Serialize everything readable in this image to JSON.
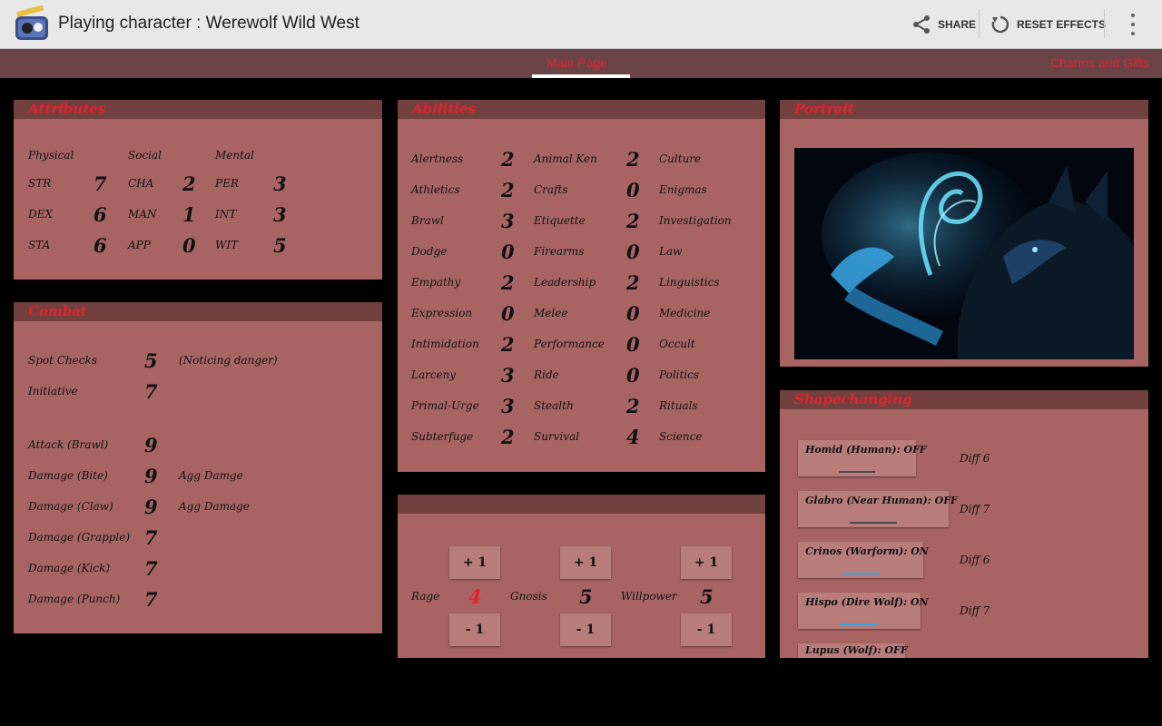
{
  "app": {
    "title": "Playing character : Werewolf Wild West",
    "share_label": "SHARE",
    "reset_label": "RESET EFFECTS"
  },
  "tabs": [
    {
      "label": "Main Page"
    },
    {
      "label": "Charms and Gifts"
    }
  ],
  "attributes": {
    "title": "Attributes",
    "headers": [
      "Physical",
      "Social",
      "Mental"
    ],
    "rows": [
      [
        {
          "label": "STR",
          "value": "7"
        },
        {
          "label": "CHA",
          "value": "2"
        },
        {
          "label": "PER",
          "value": "3"
        }
      ],
      [
        {
          "label": "DEX",
          "value": "6"
        },
        {
          "label": "MAN",
          "value": "1"
        },
        {
          "label": "INT",
          "value": "3"
        }
      ],
      [
        {
          "label": "STA",
          "value": "6"
        },
        {
          "label": "APP",
          "value": "0"
        },
        {
          "label": "WIT",
          "value": "5"
        }
      ]
    ]
  },
  "combat": {
    "title": "Combat",
    "rows": [
      {
        "label": "Spot Checks",
        "value": "5",
        "note": "(Noticing danger)"
      },
      {
        "label": "Initiative",
        "value": "7",
        "note": ""
      },
      {
        "label": "Attack (Brawl)",
        "value": "9",
        "note": ""
      },
      {
        "label": "Damage (Bite)",
        "value": "9",
        "note": "Agg Damge"
      },
      {
        "label": "Damage (Claw)",
        "value": "9",
        "note": "Agg Damage"
      },
      {
        "label": "Damage (Grapple)",
        "value": "7",
        "note": ""
      },
      {
        "label": "Damage (Kick)",
        "value": "7",
        "note": ""
      },
      {
        "label": "Damage (Punch)",
        "value": "7",
        "note": ""
      }
    ]
  },
  "abilities": {
    "title": "Abilities",
    "rows": [
      [
        {
          "label": "Alertness",
          "value": "2"
        },
        {
          "label": "Animal Ken",
          "value": "2"
        },
        {
          "label": "Culture"
        }
      ],
      [
        {
          "label": "Athletics",
          "value": "2"
        },
        {
          "label": "Crafts",
          "value": "0"
        },
        {
          "label": "Enigmas"
        }
      ],
      [
        {
          "label": "Brawl",
          "value": "3"
        },
        {
          "label": "Etiquette",
          "value": "2"
        },
        {
          "label": "Investigation"
        }
      ],
      [
        {
          "label": "Dodge",
          "value": "0"
        },
        {
          "label": "Firearms",
          "value": "0"
        },
        {
          "label": "Law"
        }
      ],
      [
        {
          "label": "Empathy",
          "value": "2"
        },
        {
          "label": "Leadership",
          "value": "2"
        },
        {
          "label": "Linguistics"
        }
      ],
      [
        {
          "label": "Expression",
          "value": "0"
        },
        {
          "label": "Melee",
          "value": "0"
        },
        {
          "label": "Medicine"
        }
      ],
      [
        {
          "label": "Intimidation",
          "value": "2"
        },
        {
          "label": "Performance",
          "value": "0"
        },
        {
          "label": "Occult"
        }
      ],
      [
        {
          "label": "Larceny",
          "value": "3"
        },
        {
          "label": "Ride",
          "value": "0"
        },
        {
          "label": "Politics"
        }
      ],
      [
        {
          "label": "Primal-Urge",
          "value": "3"
        },
        {
          "label": "Stealth",
          "value": "2"
        },
        {
          "label": "Rituals"
        }
      ],
      [
        {
          "label": "Subterfuge",
          "value": "2"
        },
        {
          "label": "Survival",
          "value": "4"
        },
        {
          "label": "Science"
        }
      ]
    ]
  },
  "resources": {
    "inc_label": "+ 1",
    "dec_label": "- 1",
    "items": [
      {
        "label": "Rage",
        "value": "4",
        "color": "#e0242c"
      },
      {
        "label": "Gnosis",
        "value": "5",
        "color": "#111111"
      },
      {
        "label": "Willpower",
        "value": "5",
        "color": "#111111"
      }
    ]
  },
  "portrait": {
    "title": "Portrait"
  },
  "shapechanging": {
    "title": "Shapechanging",
    "forms": [
      {
        "label": "Homid (Human): OFF",
        "on": false,
        "diff": "Diff 6"
      },
      {
        "label": "Glabro (Near Human): OFF",
        "on": false,
        "diff": "Diff 7"
      },
      {
        "label": "Crinos (Warform): ON",
        "on": true,
        "diff": "Diff 6"
      },
      {
        "label": "Hispo (Dire Wolf): ON",
        "on": true,
        "diff": "Diff 7"
      },
      {
        "label": "Lupus (Wolf): OFF",
        "on": false,
        "diff": ""
      }
    ]
  },
  "colors": {
    "panel": "#a86463",
    "panel_header": "#72403f",
    "header_text": "#e0242c",
    "tab_bar": "#6b4448",
    "toggle_on": "#3aa3e0"
  },
  "icons": [
    "app-icon",
    "share-icon",
    "reset-icon",
    "overflow-menu-icon"
  ]
}
